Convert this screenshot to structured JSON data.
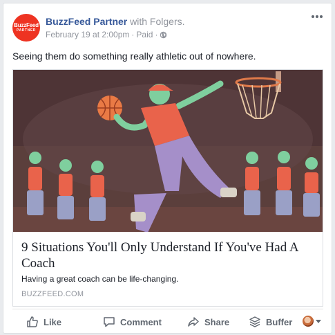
{
  "post": {
    "avatar_line1": "BuzzFeed",
    "avatar_line2": "PARTNER",
    "page_name": "BuzzFeed Partner",
    "with_text": " with Folgers.",
    "timestamp": "February 19 at 2:00pm",
    "separator": " · ",
    "paid_label": "Paid",
    "separator2": " · ",
    "message": "Seeing them do something really athletic out of nowhere."
  },
  "link": {
    "title": "9 Situations You'll Only Understand If You've Had A Coach",
    "description": "Having a great coach can be life-changing.",
    "domain": "BUZZFEED.COM"
  },
  "actions": {
    "like": "Like",
    "comment": "Comment",
    "share": "Share",
    "buffer": "Buffer"
  },
  "icons": [
    "globe-icon",
    "more-options-icon",
    "thumbs-up-icon",
    "comment-icon",
    "share-arrow-icon",
    "buffer-stack-icon",
    "chevron-down-icon"
  ],
  "colors": {
    "accent": "#365899",
    "brand_red": "#ee3322",
    "meta_gray": "#90949c",
    "action_gray": "#606770"
  }
}
